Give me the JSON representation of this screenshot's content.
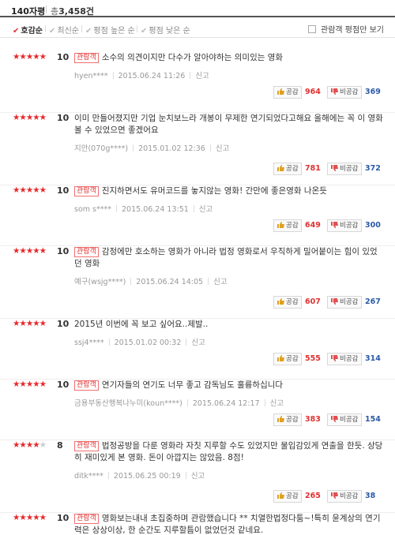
{
  "header": {
    "title": "140자평",
    "total_prefix": "총",
    "total_count": "3,458건"
  },
  "sort": {
    "items": [
      {
        "label": "호감순",
        "active": true
      },
      {
        "label": "최신순",
        "active": false
      },
      {
        "label": "평점 높은 순",
        "active": false
      },
      {
        "label": "평점 낮은 순",
        "active": false
      }
    ],
    "filter_label": "관람객 평점만 보기"
  },
  "labels": {
    "like": "공감",
    "dislike": "비공감",
    "report": "신고",
    "viewer_badge": "관람객"
  },
  "colors": {
    "star": "#e8282b",
    "like_count": "#e03030",
    "dislike_count": "#2b5aa6"
  },
  "reviews": [
    {
      "stars": 5,
      "score": "10",
      "viewer": true,
      "text": "소수의 의견이지만 다수가 알아야하는 의미있는 영화",
      "user": "hyen****",
      "date": "2015.06.24 11:26",
      "likes": "964",
      "dislikes": "369"
    },
    {
      "stars": 5,
      "score": "10",
      "viewer": false,
      "text": "이미 만들어졌지만 기업 눈치보느라 개봉이 무제한 연기되었다고해요 올해에는 꼭 이 영화 볼 수 있었으면 좋겠어요",
      "user": "지안(070g****)",
      "date": "2015.01.02 12:36",
      "likes": "781",
      "dislikes": "372"
    },
    {
      "stars": 5,
      "score": "10",
      "viewer": true,
      "text": "진지하면서도 유머코드를 놓지않는 영화! 간만에 좋은영화 나온듯",
      "user": "som s****",
      "date": "2015.06.24 13:51",
      "likes": "649",
      "dislikes": "300"
    },
    {
      "stars": 5,
      "score": "10",
      "viewer": true,
      "text": "감정에만 호소하는 영화가 아니라 법정 영화로서 우직하게 밀어붙이는 힘이 있었던 영화",
      "user": "예구(wsjg****)",
      "date": "2015.06.24 14:05",
      "likes": "607",
      "dislikes": "267"
    },
    {
      "stars": 5,
      "score": "10",
      "viewer": false,
      "text": "2015년 이번에 꼭 보고 싶어요..제발..",
      "user": "ssj4****",
      "date": "2015.01.02 00:32",
      "likes": "555",
      "dislikes": "314"
    },
    {
      "stars": 5,
      "score": "10",
      "viewer": true,
      "text": "연기자들의 연기도 너무 좋고 감독님도 훌륭하십니다",
      "user": "금용부동산행복나누미(koun****)",
      "date": "2015.06.24 12:17",
      "likes": "383",
      "dislikes": "154"
    },
    {
      "stars": 4,
      "score": "8",
      "viewer": true,
      "text": "법정공방을 다룬 영화라 자칫 지루할 수도 있었지만 물입감있게 연출을 한듯. 상당히 재미있게 본 영화. 돈이 아깝지는 않았음. 8점!",
      "user": "ditk****",
      "date": "2015.06.25 00:19",
      "likes": "265",
      "dislikes": "38"
    },
    {
      "stars": 5,
      "score": "10",
      "viewer": true,
      "text": "영화보는내내 초집중하며 관람했습니다 ** 치열한법정다툼~!특히 윤계상의 연기력은 상상이상, 한 순간도 지루할틈이 없었던것 같네요.",
      "user": "",
      "date": "",
      "likes": "",
      "dislikes": ""
    }
  ]
}
